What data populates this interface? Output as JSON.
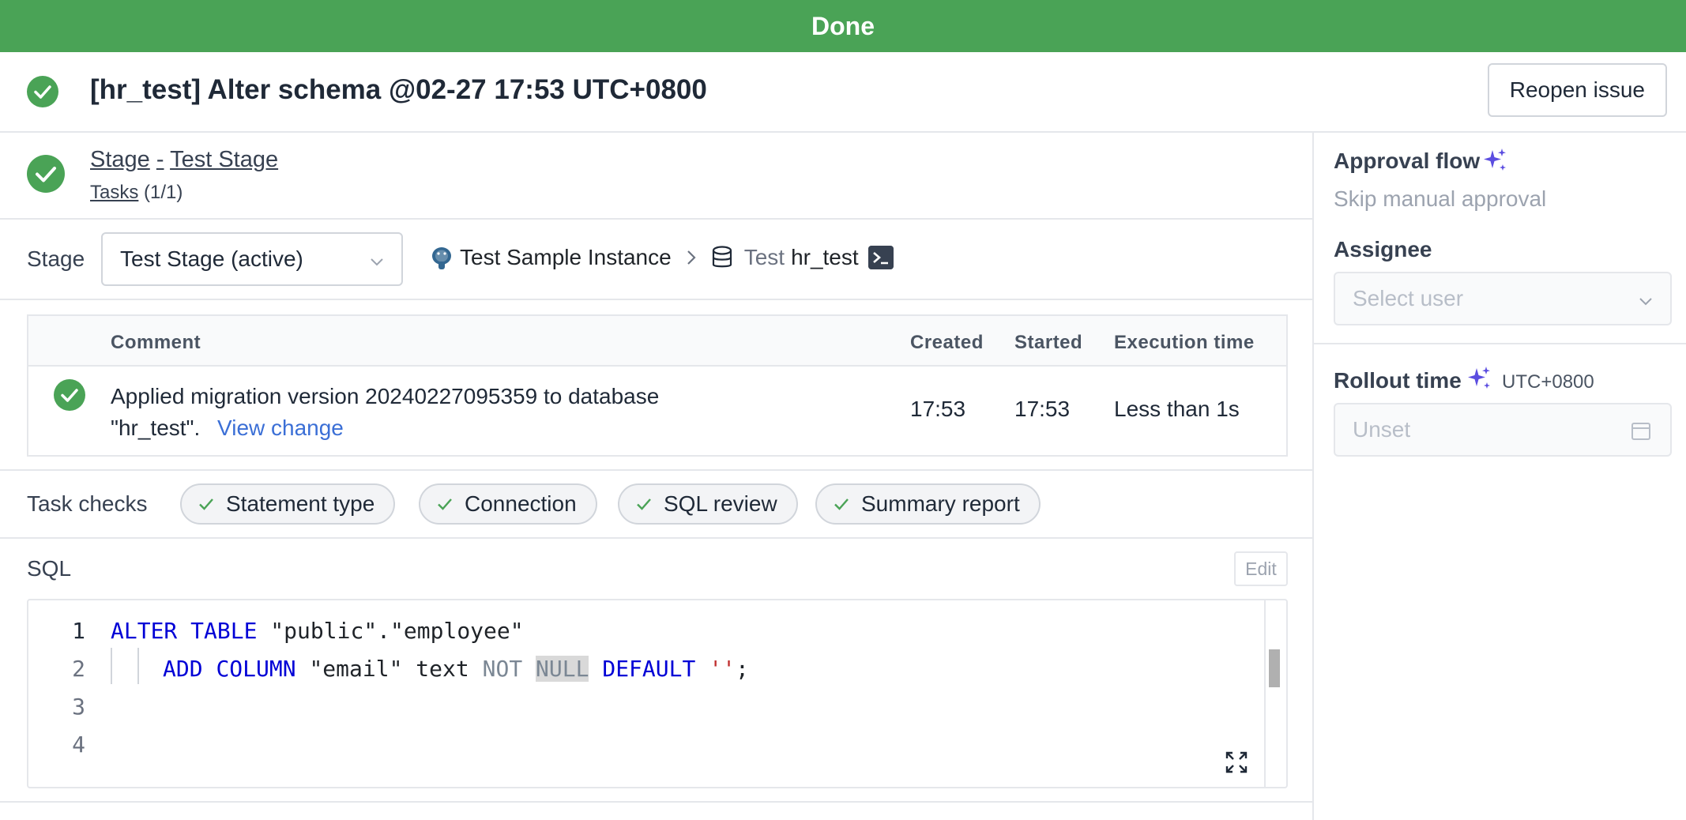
{
  "banner": {
    "status": "Done"
  },
  "issue": {
    "title": "[hr_test] Alter schema @02-27 17:53 UTC+0800",
    "reopen_label": "Reopen issue"
  },
  "stage_header": {
    "stage_word": "Stage",
    "separator": "-",
    "stage_name": "Test Stage",
    "tasks_label": "Tasks",
    "tasks_count": "(1/1)"
  },
  "stage_row": {
    "label": "Stage",
    "selected": "Test Stage (active)",
    "instance": "Test Sample Instance",
    "environment": "Test",
    "database": "hr_test"
  },
  "task_table": {
    "columns": [
      "Comment",
      "Created",
      "Started",
      "Execution time"
    ],
    "row": {
      "comment": "Applied migration version 20240227095359 to database \"hr_test\".",
      "link": "View change",
      "created": "17:53",
      "started": "17:53",
      "execution_time": "Less than 1s"
    }
  },
  "task_checks": {
    "label": "Task checks",
    "chips": [
      "Statement type",
      "Connection",
      "SQL review",
      "Summary report"
    ]
  },
  "sql": {
    "label": "SQL",
    "edit_label": "Edit",
    "line_numbers": [
      "1",
      "2",
      "3",
      "4"
    ]
  },
  "sidebar": {
    "approval_title": "Approval flow",
    "approval_value": "Skip manual approval",
    "assignee_title": "Assignee",
    "assignee_placeholder": "Select user",
    "rollout_title": "Rollout time",
    "rollout_tz": "UTC+0800",
    "rollout_placeholder": "Unset"
  },
  "colors": {
    "success": "#4aa356",
    "link": "#3b6fd6",
    "sparkle": "#5b4de0",
    "keyword": "#0000d6"
  }
}
